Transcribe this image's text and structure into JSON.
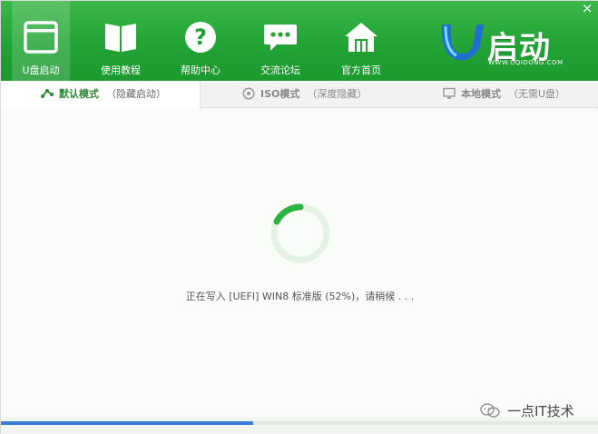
{
  "window": {
    "close_glyph": "×"
  },
  "nav": {
    "items": [
      {
        "label": "U盘启动",
        "icon": "window-icon",
        "active": true
      },
      {
        "label": "使用教程",
        "icon": "book-icon",
        "active": false
      },
      {
        "label": "帮助中心",
        "icon": "help-icon",
        "active": false
      },
      {
        "label": "交流论坛",
        "icon": "chat-icon",
        "active": false
      },
      {
        "label": "官方首页",
        "icon": "home-icon",
        "active": false
      }
    ]
  },
  "brand": {
    "text": "启动",
    "url": "WWW.UQIDONG.COM",
    "letter": "U"
  },
  "tabs": [
    {
      "label": "默认模式",
      "sub": "（隐藏启动）",
      "icon": "usb-icon",
      "active": true
    },
    {
      "label": "ISO模式",
      "sub": "（深度隐藏）",
      "icon": "disc-icon",
      "active": false
    },
    {
      "label": "本地模式",
      "sub": "（无需U盘）",
      "icon": "monitor-icon",
      "active": false
    }
  ],
  "status": {
    "text": "正在写入 [UEFI] WIN8 标准版 (52%)，请稍候 . . .",
    "percent": 52
  },
  "watermark": {
    "text": "一点IT技术"
  },
  "colors": {
    "accent": "#22a335",
    "progress": "#3a7bd5",
    "spinner": "#2bb33f",
    "spinner_track": "#e3f2e4"
  }
}
